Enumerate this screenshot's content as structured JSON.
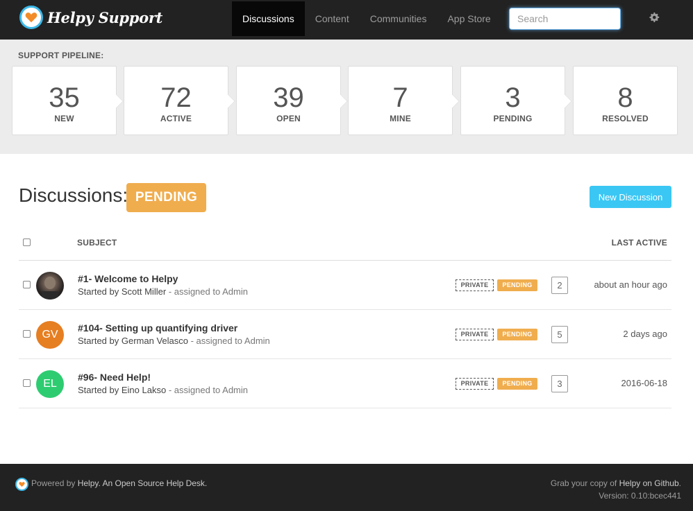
{
  "brand": {
    "name": "Helpy Support",
    "accent": "#3bb8e8",
    "heart": "#f28c28"
  },
  "nav": {
    "items": [
      {
        "label": "Discussions",
        "active": true
      },
      {
        "label": "Content"
      },
      {
        "label": "Communities"
      },
      {
        "label": "App Store"
      }
    ],
    "search_placeholder": "Search"
  },
  "pipeline": {
    "label": "SUPPORT PIPELINE:",
    "boxes": [
      {
        "count": "35",
        "label": "NEW"
      },
      {
        "count": "72",
        "label": "ACTIVE"
      },
      {
        "count": "39",
        "label": "OPEN"
      },
      {
        "count": "7",
        "label": "MINE"
      },
      {
        "count": "3",
        "label": "PENDING"
      },
      {
        "count": "8",
        "label": "RESOLVED"
      }
    ]
  },
  "main": {
    "title": "Discussions:",
    "status": "PENDING",
    "status_color": "#f0ad4e",
    "new_button": "New Discussion",
    "columns": {
      "subject": "SUBJECT",
      "last_active": "LAST ACTIVE"
    },
    "rows": [
      {
        "avatar": "",
        "avatar_color": "#333333",
        "subject": "#1- Welcome to Helpy",
        "started": "Started by Scott Miller",
        "assigned": " - assigned to Admin",
        "private": "PRIVATE",
        "status": "PENDING",
        "count": "2",
        "last_active": "about an hour ago"
      },
      {
        "avatar": "GV",
        "avatar_color": "#e67e22",
        "subject": "#104- Setting up quantifying driver",
        "started": "Started by German Velasco",
        "assigned": " - assigned to Admin",
        "private": "PRIVATE",
        "status": "PENDING",
        "count": "5",
        "last_active": "2 days ago"
      },
      {
        "avatar": "EL",
        "avatar_color": "#2ecc71",
        "subject": "#96- Need Help!",
        "started": "Started by Eino Lakso",
        "assigned": " - assigned to Admin",
        "private": "PRIVATE",
        "status": "PENDING",
        "count": "3",
        "last_active": "2016-06-18"
      }
    ]
  },
  "footer": {
    "powered": "Powered by ",
    "helpy": "Helpy",
    "tagline": ". An Open Source Help Desk.",
    "grab": "Grab your copy of ",
    "grab_link": "Helpy on Github",
    "grab_end": ".",
    "version": "Version: 0.10:bcec441"
  }
}
